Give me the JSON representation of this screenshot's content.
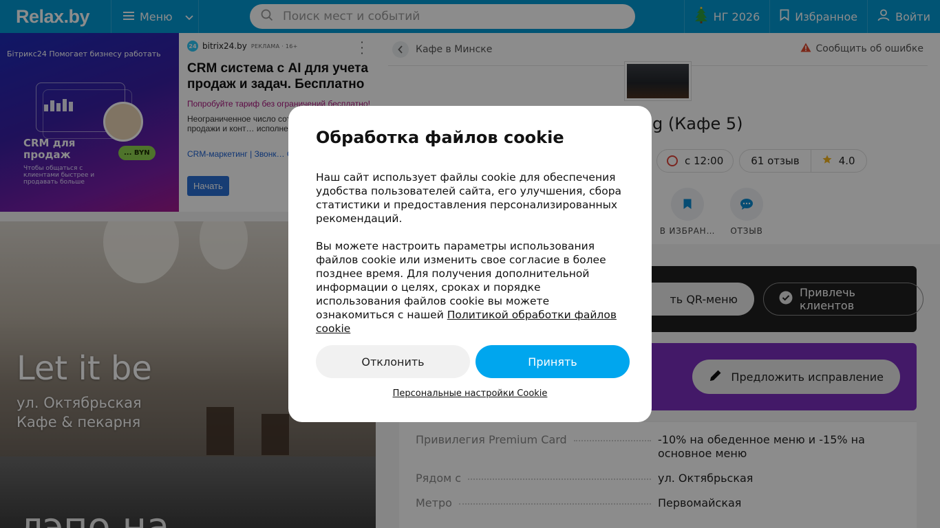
{
  "header": {
    "logo": "Relax.by",
    "menu_label": "Меню",
    "search_placeholder": "Поиск мест и событий",
    "ny_label": "НГ 2026",
    "favorites_label": "Избранное",
    "login_label": "Войти",
    "accent_color": "#0399d4"
  },
  "ad": {
    "source": "bitrix24.by",
    "badge": "РЕКЛАМА · 16+",
    "title": "CRM система с AI для учета продаж и задач. Бесплатно",
    "subtitle": "Попробуйте тариф без ограничений бесплатно!",
    "desc": "Неограниченное число сот… Повышает продажи и конт… исполнение задач!",
    "links": "CRM-маркетинг   |   Звонк… Обмен данными с 1С",
    "cta": "Начать",
    "image_brand": "Бітрикс24  Помогает бизнесу работать",
    "image_big": "CRM для продаж",
    "image_small": "Чтобы общаться с клиентами быстрее и продавать больше",
    "image_byn": "... BYN"
  },
  "promo": {
    "title": "Let it be",
    "line1": "ул. Октябрьская",
    "line2": "Кафе & пекарня",
    "next_title": "лэпо на"
  },
  "place": {
    "breadcrumb": "Кафе в Минске",
    "report": "Сообщить об ошибке",
    "title": "g (Кафе 5)",
    "hours": "с 12:00",
    "reviews": "61 отзыв",
    "rating": "4.0",
    "action_fav": "В ИЗБРАН…",
    "action_review": "ОТЗЫВ",
    "qr_menu": "ть QR-меню",
    "attract_clients": "Привлечь клиентов",
    "suggest_fix": "Предложить исправление",
    "info": [
      {
        "k": "Привилегия Premium Card",
        "v": "-10% на обеденное меню и -15% на основное меню"
      },
      {
        "k": "Рядом с",
        "v": "ул. Октябрьская"
      },
      {
        "k": "Метро",
        "v": "Первомайская"
      }
    ]
  },
  "cookie": {
    "title": "Обработка файлов cookie",
    "para1": "Наш сайт использует файлы cookie для обеспечения удобства пользователей сайта, его улучшения, сбора статистики и предоставления персонализированных рекомендаций.",
    "para2": "Вы можете настроить параметры использования файлов cookie или изменить свое согласие в более позднее время. Для получения дополнительной информации о целях, сроках и порядке использования файлов cookie вы можете ознакомиться с нашей",
    "policy_link": "Политикой обработки файлов cookie",
    "decline": "Отклонить",
    "accept": "Принять",
    "personal": "Персональные настройки Cookie"
  }
}
